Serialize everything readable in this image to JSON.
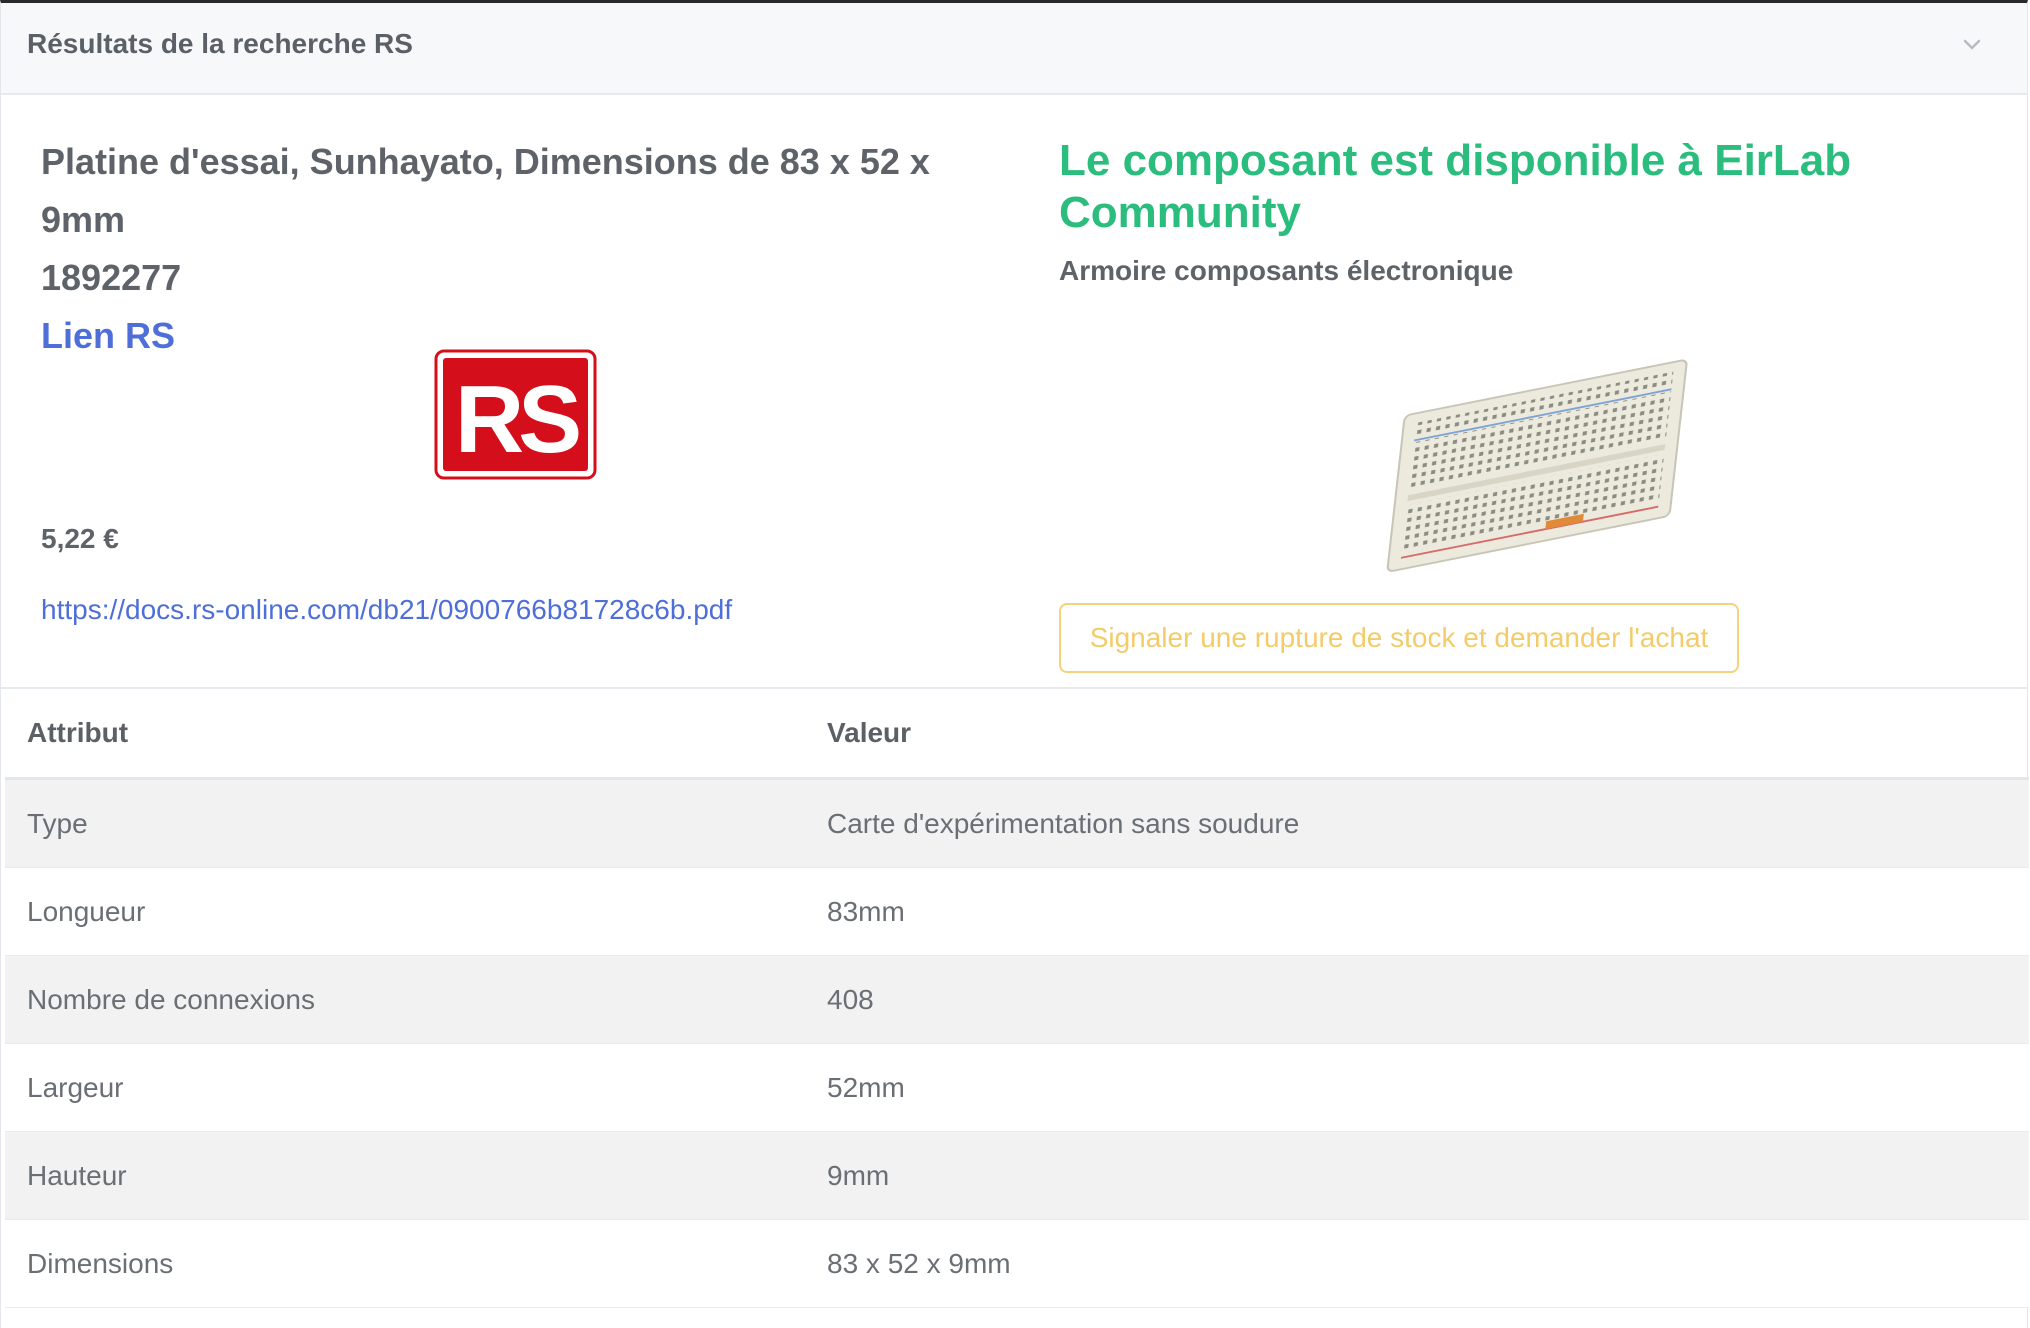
{
  "panel": {
    "title": "Résultats de la recherche RS",
    "collapse_icon": "chevron-down-icon"
  },
  "product": {
    "name": "Platine d'essai, Sunhayato, Dimensions de 83 x 52 x 9mm",
    "reference": "1892277",
    "link_label": "Lien RS",
    "logo_icon": "rs-logo",
    "logo_text": "RS",
    "price": "5,22 €",
    "datasheet_url": "https://docs.rs-online.com/db21/0900766b81728c6b.pdf"
  },
  "availability": {
    "title": "Le composant est disponible à EirLab Community",
    "location": "Armoire composants électronique",
    "image_icon": "breadboard-image",
    "report_button": "Signaler une rupture de stock et demander l'achat"
  },
  "table": {
    "headers": {
      "attribute": "Attribut",
      "value": "Valeur"
    },
    "rows": [
      {
        "attribute": "Type",
        "value": "Carte d'expérimentation sans soudure"
      },
      {
        "attribute": "Longueur",
        "value": "83mm"
      },
      {
        "attribute": "Nombre de connexions",
        "value": "408"
      },
      {
        "attribute": "Largeur",
        "value": "52mm"
      },
      {
        "attribute": "Hauteur",
        "value": "9mm"
      },
      {
        "attribute": "Dimensions",
        "value": "83 x 52 x 9mm"
      }
    ]
  },
  "colors": {
    "link": "#4f6fd8",
    "available": "#2bbd7e",
    "warning": "#f6d37a",
    "rs_red": "#d40e1a"
  }
}
